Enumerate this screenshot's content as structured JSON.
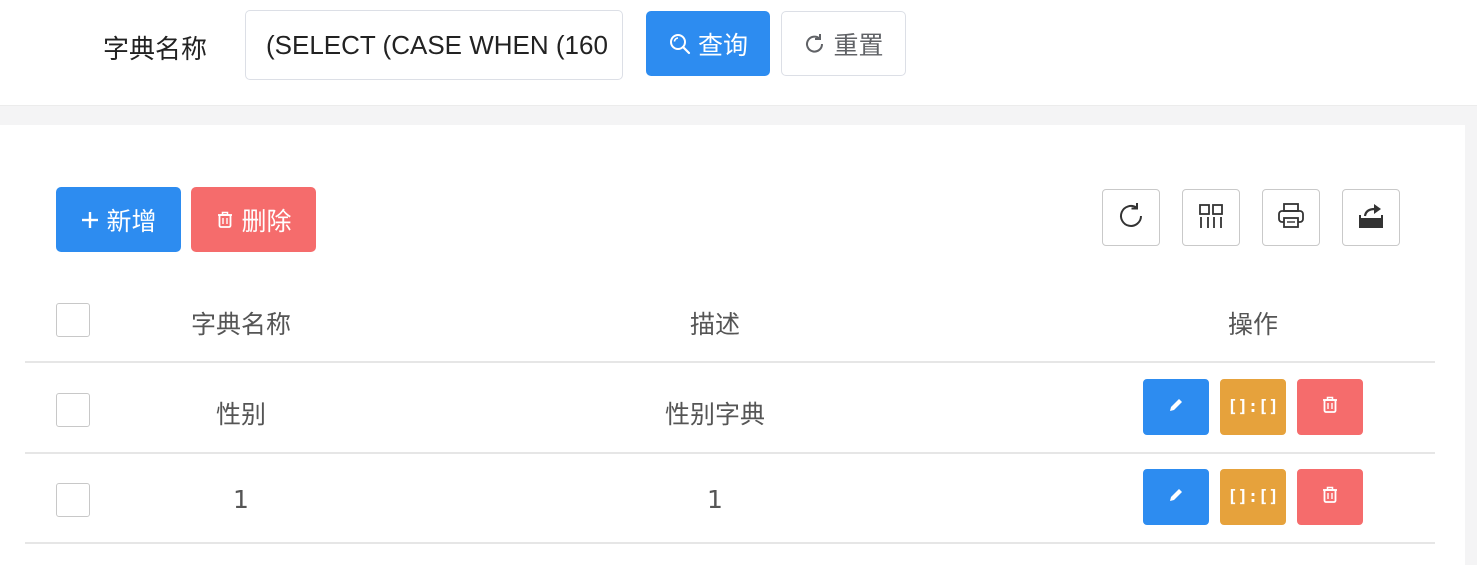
{
  "search": {
    "label": "字典名称",
    "value": "(SELECT (CASE WHEN (160",
    "query_label": "查询",
    "reset_label": "重置"
  },
  "toolbar": {
    "add_label": "新增",
    "delete_label": "删除",
    "tools": [
      "refresh-icon",
      "columns-icon",
      "print-icon",
      "export-icon"
    ]
  },
  "table": {
    "headers": {
      "name": "字典名称",
      "desc": "描述",
      "actions": "操作"
    },
    "rows": [
      {
        "name": "性别",
        "desc": "性别字典",
        "actions": [
          "edit-icon",
          "dict-data-icon",
          "trash-icon"
        ]
      },
      {
        "name": "1",
        "desc": "1",
        "actions": [
          "edit-icon",
          "dict-data-icon",
          "trash-icon"
        ]
      }
    ],
    "dict_icon_text": "[]:[]"
  },
  "colors": {
    "primary": "#2d8cf0",
    "danger": "#f56c6c",
    "warning": "#e6a23c"
  }
}
